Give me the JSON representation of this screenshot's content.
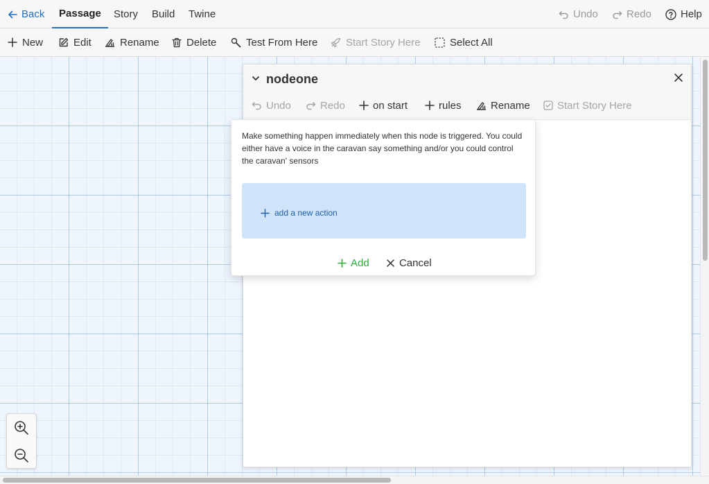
{
  "topbar": {
    "back": "Back",
    "tabs": [
      "Passage",
      "Story",
      "Build",
      "Twine"
    ],
    "undo": "Undo",
    "redo": "Redo",
    "help": "Help"
  },
  "toolbar": {
    "new": "New",
    "edit": "Edit",
    "rename": "Rename",
    "delete": "Delete",
    "test_from_here": "Test From Here",
    "start_story_here": "Start Story Here",
    "select_all": "Select All"
  },
  "dialog": {
    "title": "nodeone",
    "toolbar": {
      "undo": "Undo",
      "redo": "Redo",
      "on_start": "on start",
      "rules": "rules",
      "rename": "Rename",
      "start_story_here": "Start Story Here"
    }
  },
  "popover": {
    "description": "Make something happen immediately when this node is triggered. You could either have a voice in the caravan say something and/or you could control the caravan' sensors",
    "add_action": "add a new action",
    "add": "Add",
    "cancel": "Cancel"
  },
  "colors": {
    "accent": "#1f6fc5",
    "add_green": "#2eaa3a",
    "action_box": "#cfe3fb",
    "grid_bg": "#eef5fd"
  }
}
